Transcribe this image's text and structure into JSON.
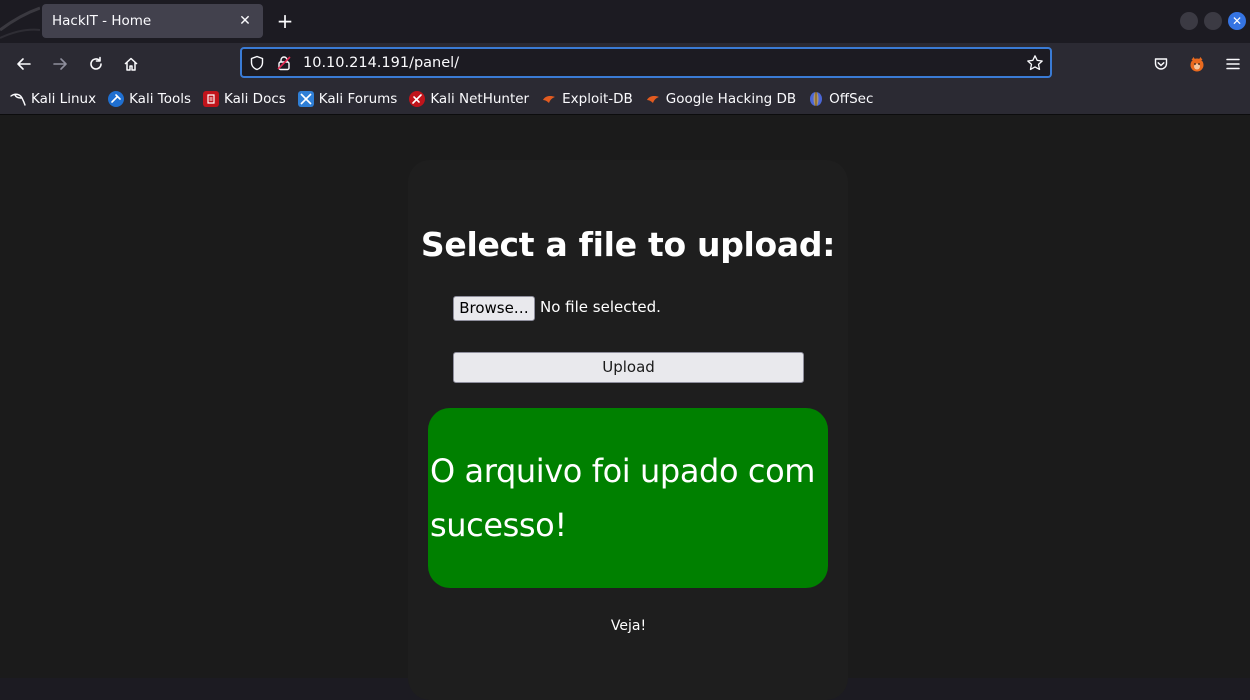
{
  "browser": {
    "tab": {
      "title": "HackIT - Home",
      "close": "✕"
    },
    "new_tab": "+",
    "url": "10.10.214.191/panel/",
    "accent": "#3574e3"
  },
  "bookmarks": [
    {
      "label": "Kali Linux",
      "icon": "kali-dragon-icon",
      "color": "#2b2a33"
    },
    {
      "label": "Kali Tools",
      "icon": "kali-tools-icon",
      "color": "#1f6fd1"
    },
    {
      "label": "Kali Docs",
      "icon": "kali-docs-icon",
      "color": "#c0141b"
    },
    {
      "label": "Kali Forums",
      "icon": "kali-forums-icon",
      "color": "#2f7fd6"
    },
    {
      "label": "Kali NetHunter",
      "icon": "kali-nethunter-icon",
      "color": "#c0141b"
    },
    {
      "label": "Exploit-DB",
      "icon": "exploit-db-icon",
      "color": "#e25b20"
    },
    {
      "label": "Google Hacking DB",
      "icon": "ghdb-icon",
      "color": "#e25b20"
    },
    {
      "label": "OffSec",
      "icon": "offsec-icon",
      "color": "#4b66d6"
    }
  ],
  "page": {
    "heading": "Select a file to upload:",
    "browse_label": "Browse…",
    "no_file_label": "No file selected.",
    "upload_label": "Upload",
    "success_message": "O arquivo foi upado com sucesso!",
    "success_color": "#008000",
    "link_label": "Veja!"
  }
}
